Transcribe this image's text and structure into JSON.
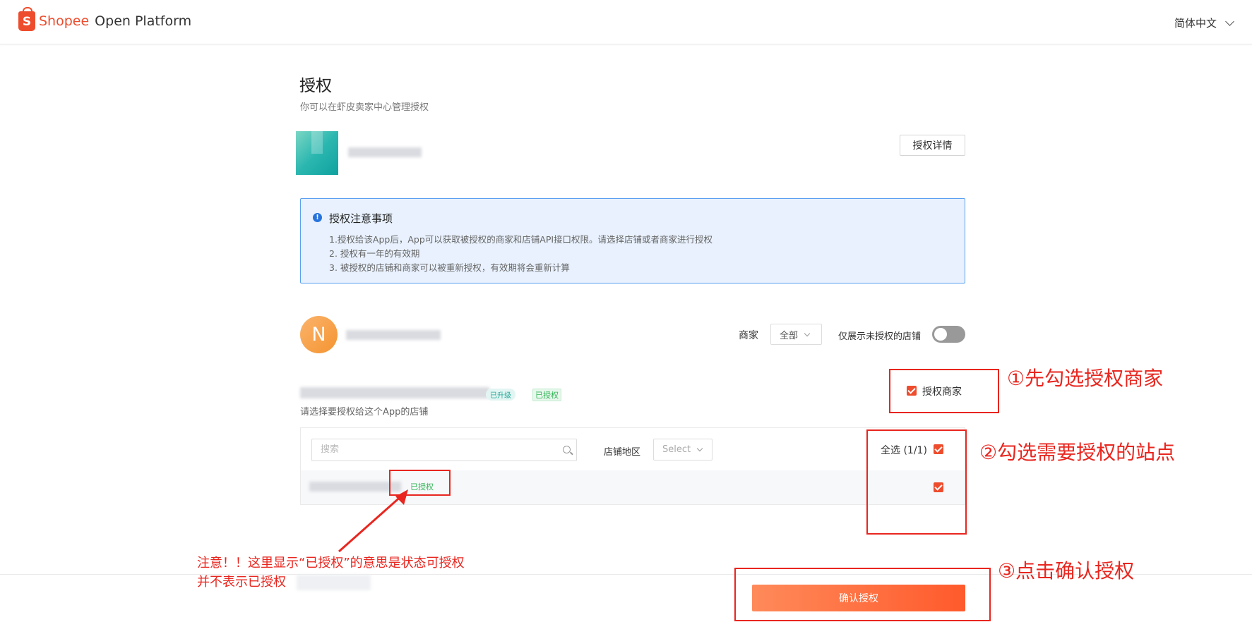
{
  "header": {
    "logo_mark": "S",
    "brand": "Shopee",
    "product": "Open Platform",
    "language": "简体中文"
  },
  "page": {
    "title": "授权",
    "subtitle": "你可以在虾皮卖家中心管理授权",
    "detail_button": "授权详情"
  },
  "notice": {
    "icon": "info-icon",
    "title": "授权注意事项",
    "lines": [
      "1.授权给该App后，App可以获取被授权的商家和店铺API接口权限。请选择店铺或者商家进行授权",
      "2. 授权有一年的有效期",
      "3. 被授权的店铺和商家可以被重新授权，有效期将会重新计算"
    ]
  },
  "merchant": {
    "avatar_letter": "N",
    "filter_label": "商家",
    "filter_value": "全部",
    "toggle_label": "仅展示未授权的店铺",
    "toggle_on": false,
    "upgrade_tag": "已升级",
    "status_tag": "已授权",
    "authorize_merchant_label": "授权商家",
    "authorize_merchant_checked": true,
    "shops_hint": "请选择要授权给这个App的店铺"
  },
  "shops": {
    "search_placeholder": "搜索",
    "region_label": "店铺地区",
    "region_placeholder": "Select",
    "select_all_label": "全选 (1/1)",
    "select_all_checked": true,
    "rows": [
      {
        "status": "已授权",
        "checked": true
      }
    ]
  },
  "footer": {
    "confirm_button": "确认授权"
  },
  "annotations": {
    "step1": "①先勾选授权商家",
    "step2": "②勾选需要授权的站点",
    "step3": "③点击确认授权",
    "note_line1": "注意！！这里显示“已授权”的意思是状态可授权",
    "note_line2": "并不表示已授权"
  },
  "colors": {
    "brand": "#ee4d2d",
    "annotation": "#e8261f",
    "notice_bg": "#e8f1fd",
    "notice_border": "#5aa0f0"
  }
}
